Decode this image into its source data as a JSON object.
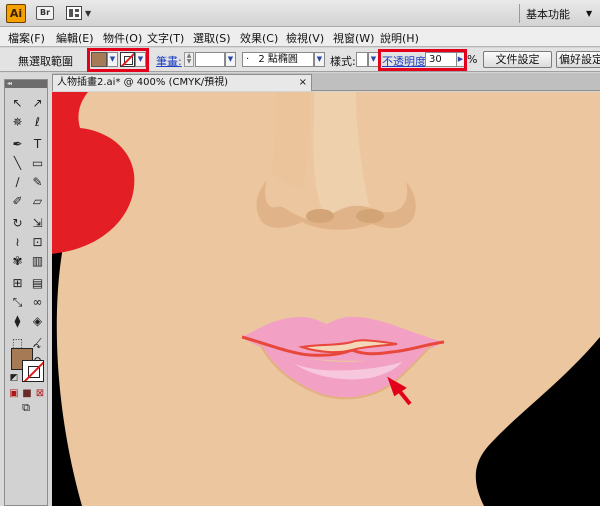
{
  "titlebar": {
    "app_logo": "Ai",
    "bridge_label": "Br",
    "workspace_label": "基本功能",
    "icons": [
      "bridge-icon",
      "arrange-documents-icon",
      "chevron-down-icon"
    ]
  },
  "menu": {
    "items": [
      "檔案(F)",
      "編輯(E)",
      "物件(O)",
      "文字(T)",
      "選取(S)",
      "效果(C)",
      "檢視(V)",
      "視窗(W)",
      "說明(H)"
    ]
  },
  "control_bar": {
    "selection_label": "無選取範圍",
    "fill_color": "#a57a55",
    "stroke_label": "筆畫:",
    "brush_value": "2 點橢圓",
    "brush_prefix": "·",
    "style_label": "樣式:",
    "opacity_label": "不透明度:",
    "opacity_value": "30",
    "opacity_unit": "%",
    "doc_setup_button": "文件設定",
    "preferences_button": "偏好設定"
  },
  "document": {
    "tab_title": "人物插畫2.ai* @ 400% (CMYK/預視)",
    "close_glyph": "×"
  },
  "toolbox": {
    "grip": "◂◂",
    "tools": [
      {
        "name": "selection-tool-icon",
        "glyph": "↖"
      },
      {
        "name": "direct-selection-tool-icon",
        "glyph": "↗"
      },
      {
        "name": "magic-wand-tool-icon",
        "glyph": "✵"
      },
      {
        "name": "lasso-tool-icon",
        "glyph": "ℓ"
      },
      {
        "name": "pen-tool-icon",
        "glyph": "✒"
      },
      {
        "name": "type-tool-icon",
        "glyph": "T"
      },
      {
        "name": "line-tool-icon",
        "glyph": "╲"
      },
      {
        "name": "rectangle-tool-icon",
        "glyph": "▭"
      },
      {
        "name": "paintbrush-tool-icon",
        "glyph": "∕"
      },
      {
        "name": "pencil-tool-icon",
        "glyph": "✎"
      },
      {
        "name": "blob-brush-tool-icon",
        "glyph": "✐"
      },
      {
        "name": "eraser-tool-icon",
        "glyph": "▱"
      },
      {
        "name": "rotate-tool-icon",
        "glyph": "↻"
      },
      {
        "name": "scale-tool-icon",
        "glyph": "⇲"
      },
      {
        "name": "warp-tool-icon",
        "glyph": "≀"
      },
      {
        "name": "free-transform-tool-icon",
        "glyph": "⊡"
      },
      {
        "name": "symbol-sprayer-tool-icon",
        "glyph": "✾"
      },
      {
        "name": "column-graph-tool-icon",
        "glyph": "▥"
      },
      {
        "name": "mesh-tool-icon",
        "glyph": "⊞"
      },
      {
        "name": "gradient-tool-icon",
        "glyph": "▤"
      },
      {
        "name": "eyedropper-tool-icon",
        "glyph": "⤡"
      },
      {
        "name": "blend-tool-icon",
        "glyph": "∞"
      },
      {
        "name": "live-paint-bucket-tool-icon",
        "glyph": "⧫"
      },
      {
        "name": "live-paint-selection-tool-icon",
        "glyph": "◈"
      },
      {
        "name": "artboard-tool-icon",
        "glyph": "⬚"
      },
      {
        "name": "slice-tool-icon",
        "glyph": "⟋"
      },
      {
        "name": "hand-tool-icon",
        "glyph": "✋"
      },
      {
        "name": "zoom-tool-icon",
        "glyph": "⚲"
      }
    ],
    "fill_color": "#a57a55",
    "swap_glyph": "↷",
    "default_glyph": "◩",
    "mode_glyphs": [
      "▣",
      "■",
      "⊠"
    ],
    "screen_mode_glyph": "⧉"
  },
  "colors": {
    "skin": "#ecc69e",
    "hair": "#000000",
    "flower": "#e31e24",
    "lip": "#f2a0c4",
    "lip_highlight": "#f7c8dd",
    "lip_outline": "#e8473c",
    "annotation_red": "#e3001b",
    "stroke_accent": "#1d3fbf"
  }
}
